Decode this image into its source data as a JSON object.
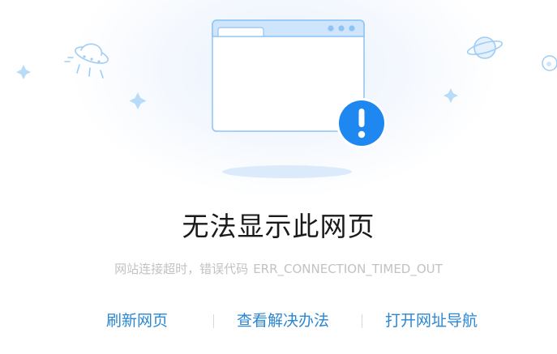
{
  "error": {
    "title": "无法显示此网页",
    "message": "网站连接超时，错误代码",
    "code": "ERR_CONNECTION_TIMED_OUT"
  },
  "actions": {
    "refresh_label": "刷新网页",
    "solutions_label": "查看解决办法",
    "open_nav_label": "打开网址导航"
  },
  "illustration": {
    "icons": [
      "ufo-icon",
      "browser-window-icon",
      "alert-badge-icon",
      "planet-icon",
      "sparkle-icon"
    ],
    "alert_color": "#1e88f0",
    "outline_color": "#8ec3f5"
  },
  "colors": {
    "link": "#2b87d1",
    "title": "#1a1a1a",
    "muted": "#c2c2c2"
  }
}
